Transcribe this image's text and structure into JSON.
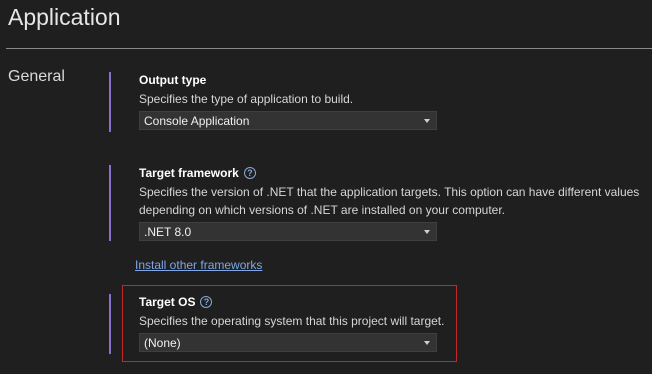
{
  "page": {
    "title": "Application"
  },
  "sidebar": {
    "section": "General"
  },
  "output_type": {
    "heading": "Output type",
    "description": "Specifies the type of application to build.",
    "value": "Console Application"
  },
  "target_framework": {
    "heading": "Target framework",
    "description_1": "Specifies the version of .NET that the application targets. This option can have different values",
    "description_2": "depending on which versions of .NET are installed on your computer.",
    "value": ".NET 8.0",
    "link": "Install other frameworks"
  },
  "target_os": {
    "heading": "Target OS",
    "description": "Specifies the operating system that this project will target.",
    "value": "(None)"
  },
  "icons": {
    "help": "?"
  },
  "colors": {
    "background": "#1f1f1f",
    "accent_bar": "#8b6fcf",
    "link": "#7fa7e8",
    "highlight_border": "#c62828"
  }
}
